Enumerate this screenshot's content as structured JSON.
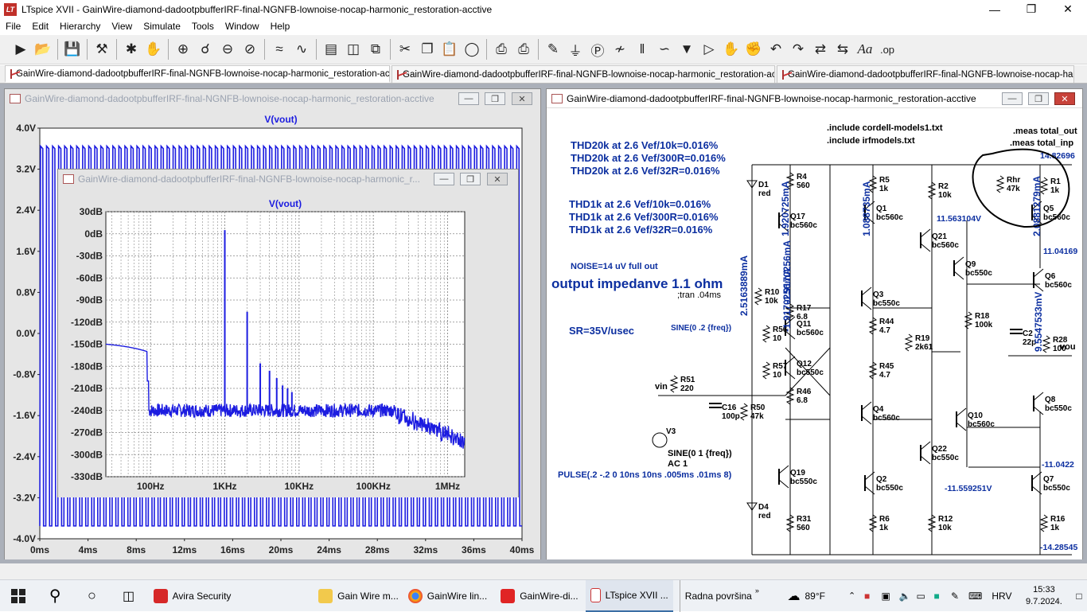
{
  "window": {
    "title": "LTspice XVII - GainWire-diamond-dadootpbufferIRF-final-NGNFB-lownoise-nocap-harmonic_restoration-acctive",
    "app_icon": "LT"
  },
  "menu": [
    "File",
    "Edit",
    "Hierarchy",
    "View",
    "Simulate",
    "Tools",
    "Window",
    "Help"
  ],
  "toolbar_icons": [
    "run-icon",
    "open-icon",
    "save-icon",
    "control-panel-icon",
    "halt-icon",
    "pan-hand-icon",
    "zoom-in-icon",
    "zoom-area-icon",
    "zoom-out-icon",
    "zoom-cancel-icon",
    "autorange-icon",
    "waveform-icon",
    "tile-horizontal-icon",
    "tile-vertical-icon",
    "cascade-icon",
    "cut-icon",
    "copy-icon",
    "paste-icon",
    "find-icon",
    "print-icon",
    "print-setup-icon",
    "pencil-icon",
    "ground-icon",
    "label-icon",
    "resistor-icon",
    "capacitor-icon",
    "inductor-icon",
    "diode-icon",
    "component-icon",
    "move-icon",
    "drag-icon",
    "undo-icon",
    "redo-icon",
    "rotate-icon",
    "mirror-icon",
    "text-icon",
    "spice-directive-icon"
  ],
  "tabs": [
    {
      "label": "GainWire-diamond-dadootpbufferIRF-final-NGNFB-lownoise-nocap-harmonic_restoration-acctive",
      "icon": "schematic-icon"
    },
    {
      "label": "GainWire-diamond-dadootpbufferIRF-final-NGNFB-lownoise-nocap-harmonic_restoration-acctive",
      "icon": "waveform-icon"
    },
    {
      "label": "GainWire-diamond-dadootpbufferIRF-final-NGNFB-lownoise-nocap-harmonic_restoration-acctive",
      "icon": "waveform-icon"
    }
  ],
  "plot_window": {
    "title": "GainWire-diamond-dadootpbufferIRF-final-NGNFB-lownoise-nocap-harmonic_restoration-acctive",
    "trace": "V(vout)",
    "y_ticks": [
      "4.0V",
      "3.2V",
      "2.4V",
      "1.6V",
      "0.8V",
      "0.0V",
      "-0.8V",
      "-1.6V",
      "-2.4V",
      "-3.2V",
      "-4.0V"
    ],
    "x_ticks": [
      "0ms",
      "4ms",
      "8ms",
      "12ms",
      "16ms",
      "20ms",
      "24ms",
      "28ms",
      "32ms",
      "36ms",
      "40ms"
    ]
  },
  "fft_window": {
    "title": "GainWire-diamond-dadootpbufferIRF-final-NGNFB-lownoise-nocap-harmonic_r...",
    "trace": "V(vout)",
    "y_ticks": [
      "30dB",
      "0dB",
      "-30dB",
      "-60dB",
      "-90dB",
      "-120dB",
      "-150dB",
      "-180dB",
      "-210dB",
      "-240dB",
      "-270dB",
      "-300dB",
      "-330dB"
    ],
    "x_ticks": [
      "100Hz",
      "1KHz",
      "10KHz",
      "100KHz",
      "1MHz"
    ]
  },
  "schematic_window": {
    "title": "GainWire-diamond-dadootpbufferIRF-final-NGNFB-lownoise-nocap-harmonic_restoration-acctive",
    "notes": {
      "thd20k": [
        "THD20k at 2.6 Vef/10k=0.016%",
        "THD20k at 2.6 Vef/300R=0.016%",
        "THD20k at 2.6 Vef/32R=0.016%"
      ],
      "thd1k": [
        "THD1k at 2.6 Vef/10k=0.016%",
        "THD1k at 2.6 Vef/300R=0.016%",
        "THD1k at 2.6 Vef/32R=0.016%"
      ],
      "noise": "NOISE=14 uV full out",
      "impedance": "output impedanve 1.1 ohm",
      "sr": "SR=35V/usec",
      "tran": ";tran .04ms",
      "sine_src": "SINE(0 .2 {freq})",
      "include1": ".include cordell-models1.txt",
      "include2": ".include irfmodels.txt",
      "meas1": ".meas total_out",
      "meas2": ".meas total_inp",
      "v3_sine": "SINE(0 1 {freq})",
      "v3_ac": "AC 1",
      "pulse": "PULSE(.2 -.2 0 10ns 10ns .005ms .01ms 8)"
    },
    "parts": [
      {
        "ref": "R4",
        "val": "560"
      },
      {
        "ref": "R5",
        "val": "1k"
      },
      {
        "ref": "R2",
        "val": "10k"
      },
      {
        "ref": "Rhr",
        "val": "47k"
      },
      {
        "ref": "R1",
        "val": "1k"
      },
      {
        "ref": "D1",
        "val": "red"
      },
      {
        "ref": "Q17",
        "val": "bc560c"
      },
      {
        "ref": "Q1",
        "val": "bc560c"
      },
      {
        "ref": "Q5",
        "val": "bc560c"
      },
      {
        "ref": "Q21",
        "val": "bc560c"
      },
      {
        "ref": "Q9",
        "val": "bc550c"
      },
      {
        "ref": "Q6",
        "val": "bc560c"
      },
      {
        "ref": "R10",
        "val": "10k"
      },
      {
        "ref": "R17",
        "val": "6.8"
      },
      {
        "ref": "Q3",
        "val": "bc550c"
      },
      {
        "ref": "R18",
        "val": "100k"
      },
      {
        "ref": "R56",
        "val": "10"
      },
      {
        "ref": "Q11",
        "val": "bc560c"
      },
      {
        "ref": "R44",
        "val": "4.7"
      },
      {
        "ref": "R19",
        "val": "2k61"
      },
      {
        "ref": "C2",
        "val": "22p"
      },
      {
        "ref": "R28",
        "val": "100"
      },
      {
        "ref": "R57",
        "val": "10"
      },
      {
        "ref": "Q12",
        "val": "bc550c"
      },
      {
        "ref": "R45",
        "val": "4.7"
      },
      {
        "ref": "R51",
        "val": "220"
      },
      {
        "ref": "R46",
        "val": "6.8"
      },
      {
        "ref": "Q4",
        "val": "bc560c"
      },
      {
        "ref": "Q8",
        "val": "bc550c"
      },
      {
        "ref": "C16",
        "val": "100p"
      },
      {
        "ref": "R50",
        "val": "47k"
      },
      {
        "ref": "Q10",
        "val": "bc560c"
      },
      {
        "ref": "V3",
        "val": ""
      },
      {
        "ref": "Q22",
        "val": "bc550c"
      },
      {
        "ref": "Q19",
        "val": "bc550c"
      },
      {
        "ref": "Q2",
        "val": "bc550c"
      },
      {
        "ref": "Q7",
        "val": "bc550c"
      },
      {
        "ref": "D4",
        "val": "red"
      },
      {
        "ref": "R31",
        "val": "560"
      },
      {
        "ref": "R6",
        "val": "1k"
      },
      {
        "ref": "R12",
        "val": "10k"
      },
      {
        "ref": "R16",
        "val": "1k"
      }
    ],
    "node_labels": [
      "vin",
      "vou"
    ],
    "op_labels": [
      "14.82696",
      "11.563104V",
      "11.04169",
      "-11.0422",
      "-11.559251V",
      "-14.28545",
      "1.920725mA",
      "1.088735mA",
      "2.0881279mA",
      "-1.9170256mA",
      "-1.9170256mA",
      "2.5163889mA",
      "9.5547533mV"
    ]
  },
  "taskbar": {
    "items": [
      "Avira Security",
      "Gain Wire m...",
      "GainWire lin...",
      "GainWire-di...",
      "LTspice XVII ...",
      "Radna površina"
    ],
    "weather": "89°F",
    "lang": "HRV",
    "time": "15:33",
    "date": "9.7.2024."
  }
}
